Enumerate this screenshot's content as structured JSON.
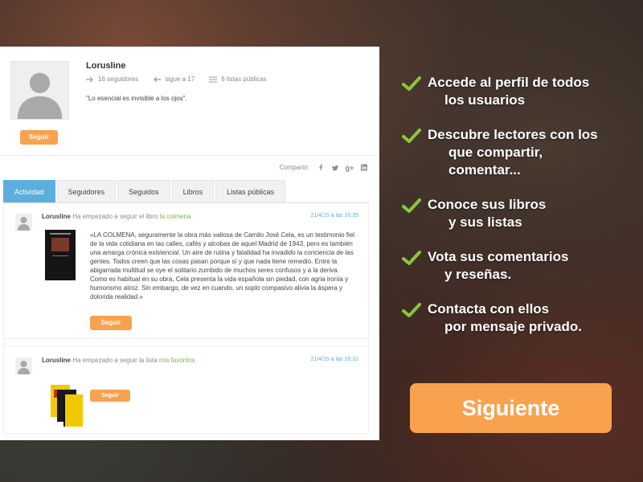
{
  "profile": {
    "username": "Lorusline",
    "followers": "16 seguidores",
    "following": "sigue a 17",
    "public_lists": "6 listas públicas",
    "quote": "\"Lo esencial es invisible a los ojos\".",
    "follow_label": "Seguir",
    "share_label": "Compartir:"
  },
  "tabs": [
    {
      "label": "Actividad",
      "active": true
    },
    {
      "label": "Seguidores"
    },
    {
      "label": "Seguidos"
    },
    {
      "label": "Libros"
    },
    {
      "label": "Listas públicas"
    }
  ],
  "activity": [
    {
      "user": "Lorusline",
      "action": "Ha empezado a seguir el libro",
      "link": "la colmena",
      "date": "21/4/15 a las 16:35",
      "text": "«LA COLMENA, seguramente la obra más valiosa de Camilo José Cela, es un testimonio fiel de la vida cotidiana en las calles, cafés y alcobas de aquel Madrid de 1943, pero es también una amarga crónica existencial. Un aire de rutina y fatalidad ha invadido la conciencia de las gentes. Todos creen que las cosas pasan porque sí y que nada tiene remedio. Entre la abigarrada multitud se oye el solitario zumbido de muchos seres confusos y a la deriva. Como es habitual en su obra, Cela presenta la vida española sin piedad, con agria ironía y humorismo atroz. Sin embargo, de vez en cuando, un soplo compasivo alivia la áspera y dolorida realidad.»",
      "follow_label": "Seguir"
    },
    {
      "user": "Lorusline",
      "action": "Ha empezado a seguir la lista",
      "link": "mis favoritos",
      "date": "21/4/15 a las 16:31",
      "follow_label": "Seguir"
    }
  ],
  "features": [
    {
      "line1": "Accede al perfil de todos",
      "line2": "los usuarios"
    },
    {
      "line1": "Descubre lectores con los",
      "line2": "que compartir,",
      "line3": "comentar..."
    },
    {
      "line1": "Conoce sus libros",
      "line2": "y sus listas"
    },
    {
      "line1": "Vota sus comentarios",
      "line2": "y reseñas."
    },
    {
      "line1": "Contacta con ellos",
      "line2": "por mensaje privado."
    }
  ],
  "next_label": "Siguiente",
  "colors": {
    "accent_orange": "#f9a24e",
    "tab_blue": "#5baede",
    "link_green": "#7ab648",
    "check_green": "#8cc63f"
  }
}
